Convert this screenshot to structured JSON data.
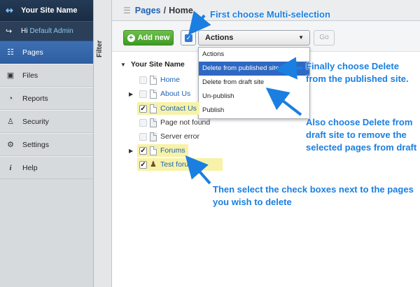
{
  "sidebar": {
    "brand": "Your Site Name",
    "greeting": "Hi",
    "user": "Default Admin",
    "items": [
      {
        "label": "Pages",
        "icon": "pages-icon"
      },
      {
        "label": "Files",
        "icon": "image-icon"
      },
      {
        "label": "Reports",
        "icon": "pie-icon"
      },
      {
        "label": "Security",
        "icon": "users-icon"
      },
      {
        "label": "Settings",
        "icon": "wrench-icon"
      },
      {
        "label": "Help",
        "icon": "info-icon"
      }
    ],
    "active": "Pages"
  },
  "filter_label": "Filter",
  "header": {
    "crumb_link": "Pages",
    "crumb_sep": "/",
    "crumb_current": "Home"
  },
  "toolbar": {
    "add_label": "Add new",
    "actions_label": "Actions",
    "go_label": "Go"
  },
  "dropdown": {
    "items": [
      "Actions",
      "Delete from published site",
      "Delete from draft site",
      "Un-publish",
      "Publish"
    ],
    "selected": "Delete from published site"
  },
  "tree": {
    "root": "Your Site Name",
    "rows": [
      {
        "label": "Home",
        "checked": false,
        "highlight": false,
        "expandable": false
      },
      {
        "label": "About Us",
        "checked": false,
        "highlight": false,
        "expandable": true
      },
      {
        "label": "Contact Us",
        "checked": true,
        "highlight": true,
        "expandable": false
      },
      {
        "label": "Page not found",
        "checked": false,
        "highlight": false,
        "expandable": false
      },
      {
        "label": "Server error",
        "checked": false,
        "highlight": false,
        "expandable": false
      },
      {
        "label": "Forums",
        "checked": true,
        "highlight": true,
        "expandable": true
      },
      {
        "label": "Test forum",
        "checked": true,
        "highlight": true,
        "expandable": false
      }
    ]
  },
  "annotations": {
    "first": "First choose Multi-selection",
    "finally": "Finally choose Delete from the published site.",
    "also": "Also choose Delete from draft site to remove the selected pages from draft",
    "then": "Then select the check boxes next to the pages you wish to delete"
  },
  "colors": {
    "annotation": "#1a7fe0",
    "highlight": "#f7f2a7",
    "active_nav": "#2f5fa3",
    "add_button": "#4fae2f"
  }
}
